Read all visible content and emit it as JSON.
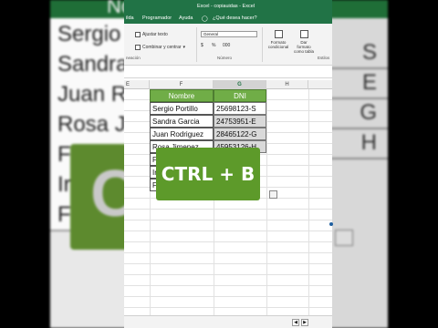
{
  "window": {
    "title": "Excel - copiauidas - Excel",
    "tabs": [
      "ilda",
      "Programador",
      "Ayuda",
      "¿Qué desea hacer?"
    ]
  },
  "ribbon": {
    "wrap_text": "Ajustar texto",
    "merge_center": "Combinar y centrar",
    "alignment_label": "neación",
    "number_format": "General",
    "number_label": "Número",
    "number_buttons": [
      "$",
      "%",
      "000"
    ],
    "cond_format": "Formato condicional",
    "table_format": "Dar formato como tabla",
    "styles_label": "Estilos"
  },
  "columns": [
    "E",
    "F",
    "G",
    "H"
  ],
  "table": {
    "headers": [
      "Nombre",
      "DNI"
    ],
    "rows": [
      {
        "name": "Sergio Portillo",
        "dni": "25698123-S"
      },
      {
        "name": "Sandra Garcia",
        "dni": "24753951-E"
      },
      {
        "name": "Juan Rodriguez",
        "dni": "28465122-G"
      },
      {
        "name": "Rosa Jimenez",
        "dni": "45953126-H"
      },
      {
        "name": "F",
        "dni": ""
      },
      {
        "name": "Ir",
        "dni": ""
      },
      {
        "name": "F",
        "dni": ""
      }
    ]
  },
  "overlay": {
    "text": "CTRL + B"
  },
  "background": {
    "header": "Nor",
    "names": [
      "Sergio P",
      "Sandra",
      "Juan Ro",
      "Rosa Jin",
      "F",
      "Ir",
      "F"
    ],
    "letters": [
      "S",
      "E",
      "G",
      "H"
    ],
    "big_text": "CT"
  },
  "colors": {
    "excel_green": "#217346",
    "table_header": "#70ad47",
    "overlay": "#5d9a2a"
  }
}
